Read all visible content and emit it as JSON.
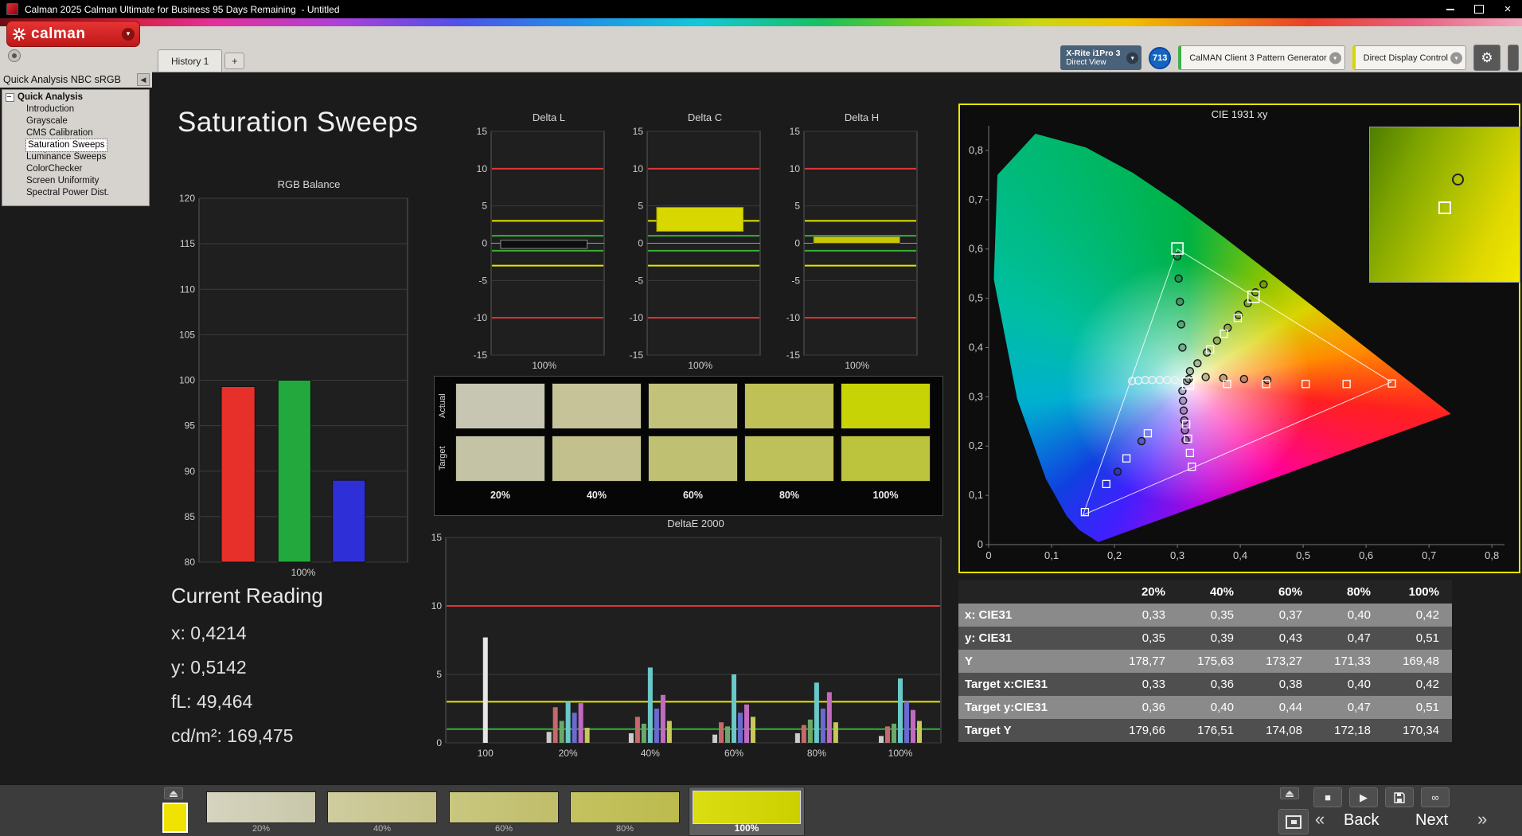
{
  "window": {
    "title": "Calman 2025 Calman Ultimate for Business 95 Days Remaining  - Untitled"
  },
  "logo": {
    "text": "calman"
  },
  "tabs": {
    "items": [
      {
        "label": "History 1"
      }
    ],
    "add_label": "+"
  },
  "devices": {
    "meter": {
      "line1": "X-Rite i1Pro 3",
      "line2": "Direct View"
    },
    "badge": "713",
    "pattern_generator": "CalMAN Client 3 Pattern Generator",
    "display_control": "Direct Display Control"
  },
  "icons": {
    "collapse": "◀",
    "dropdown": "▾",
    "gear": "⚙",
    "prev": "«",
    "next": "»",
    "stop": "■",
    "play": "▶",
    "infinity": "∞"
  },
  "sidebar": {
    "header": "Quick Analysis NBC sRGB",
    "root": "Quick Analysis",
    "items": [
      "Introduction",
      "Grayscale",
      "CMS Calibration",
      "Saturation Sweeps",
      "Luminance Sweeps",
      "ColorChecker",
      "Screen Uniformity",
      "Spectral Power Dist."
    ],
    "selected": "Saturation Sweeps"
  },
  "main": {
    "title": "Saturation Sweeps",
    "current_reading": {
      "title": "Current Reading",
      "lines": [
        "x: 0,4214",
        "y: 0,5142",
        "fL: 49,464",
        "cd/m²: 169,475"
      ]
    }
  },
  "chart_data": [
    {
      "id": "rgb_balance",
      "type": "bar",
      "title": "RGB Balance",
      "ylim": [
        80,
        120
      ],
      "ytick_step": 5,
      "categories": [
        "Red",
        "Green",
        "Blue"
      ],
      "values": [
        99.3,
        100.0,
        89.0
      ],
      "colors": [
        "#e8302a",
        "#22a83c",
        "#2f2fd8"
      ],
      "xlabel": "100%"
    },
    {
      "id": "delta_l",
      "type": "bar",
      "title": "Delta L",
      "ylim": [
        -15,
        15
      ],
      "ytick_step": 5,
      "xlabel": "100%",
      "limit_lines": [
        {
          "y": 10,
          "color": "#e03535"
        },
        {
          "y": -10,
          "color": "#e03535"
        },
        {
          "y": 3,
          "color": "#e6e600"
        },
        {
          "y": -3,
          "color": "#e6e600"
        },
        {
          "y": 1,
          "color": "#35b035"
        },
        {
          "y": -1,
          "color": "#35b035"
        }
      ],
      "bar": {
        "from": -0.7,
        "to": 0.4,
        "color": "#0d0d0d",
        "stroke": "#8a8a8a"
      }
    },
    {
      "id": "delta_c",
      "type": "bar",
      "title": "Delta C",
      "ylim": [
        -15,
        15
      ],
      "ytick_step": 5,
      "xlabel": "100%",
      "limit_lines": [
        {
          "y": 10,
          "color": "#e03535"
        },
        {
          "y": -10,
          "color": "#e03535"
        },
        {
          "y": 3,
          "color": "#e6e600"
        },
        {
          "y": -3,
          "color": "#e6e600"
        },
        {
          "y": 1,
          "color": "#35b035"
        },
        {
          "y": -1,
          "color": "#35b035"
        }
      ],
      "bar": {
        "from": 1.6,
        "to": 4.8,
        "color": "#d8d800",
        "stroke": "#9a9a00"
      }
    },
    {
      "id": "delta_h",
      "type": "bar",
      "title": "Delta H",
      "ylim": [
        -15,
        15
      ],
      "ytick_step": 5,
      "xlabel": "100%",
      "limit_lines": [
        {
          "y": 10,
          "color": "#e03535"
        },
        {
          "y": -10,
          "color": "#e03535"
        },
        {
          "y": 3,
          "color": "#e6e600"
        },
        {
          "y": -3,
          "color": "#e6e600"
        },
        {
          "y": 1,
          "color": "#35b035"
        },
        {
          "y": -1,
          "color": "#35b035"
        }
      ],
      "bar": {
        "from": 0.0,
        "to": 0.9,
        "color": "#c8c800",
        "stroke": "#555"
      }
    },
    {
      "id": "deltae",
      "type": "bar-grouped",
      "title": "DeltaE 2000",
      "ylim": [
        0,
        15
      ],
      "yticks": [
        0,
        5,
        10,
        15
      ],
      "limit_lines": [
        {
          "y": 10,
          "color": "#e03535"
        },
        {
          "y": 3,
          "color": "#e6e600"
        },
        {
          "y": 1,
          "color": "#35b035"
        }
      ],
      "groups": [
        {
          "label": "100",
          "fx": 0.08,
          "bars": [
            {
              "v": 7.7,
              "c": "#e6e6e6"
            }
          ]
        },
        {
          "label": "20%",
          "fx": 0.247,
          "bars": [
            {
              "v": 0.8,
              "c": "#cccccc"
            },
            {
              "v": 2.6,
              "c": "#c46a6a"
            },
            {
              "v": 1.6,
              "c": "#6aa86a"
            },
            {
              "v": 3.0,
              "c": "#6ac8c8"
            },
            {
              "v": 2.2,
              "c": "#6a6ad0"
            },
            {
              "v": 2.9,
              "c": "#c06ac0"
            },
            {
              "v": 1.1,
              "c": "#c8c85a"
            }
          ]
        },
        {
          "label": "40%",
          "fx": 0.413,
          "bars": [
            {
              "v": 0.7,
              "c": "#cccccc"
            },
            {
              "v": 1.9,
              "c": "#c46a6a"
            },
            {
              "v": 1.4,
              "c": "#6aa86a"
            },
            {
              "v": 5.5,
              "c": "#6ac8c8"
            },
            {
              "v": 2.5,
              "c": "#6a6ad0"
            },
            {
              "v": 3.5,
              "c": "#c06ac0"
            },
            {
              "v": 1.6,
              "c": "#c8c85a"
            }
          ]
        },
        {
          "label": "60%",
          "fx": 0.582,
          "bars": [
            {
              "v": 0.6,
              "c": "#cccccc"
            },
            {
              "v": 1.5,
              "c": "#c46a6a"
            },
            {
              "v": 1.2,
              "c": "#6aa86a"
            },
            {
              "v": 5.0,
              "c": "#6ac8c8"
            },
            {
              "v": 2.2,
              "c": "#6a6ad0"
            },
            {
              "v": 2.8,
              "c": "#c06ac0"
            },
            {
              "v": 1.9,
              "c": "#c8c85a"
            }
          ]
        },
        {
          "label": "80%",
          "fx": 0.749,
          "bars": [
            {
              "v": 0.7,
              "c": "#cccccc"
            },
            {
              "v": 1.3,
              "c": "#c46a6a"
            },
            {
              "v": 1.7,
              "c": "#6aa86a"
            },
            {
              "v": 4.4,
              "c": "#6ac8c8"
            },
            {
              "v": 2.5,
              "c": "#6a6ad0"
            },
            {
              "v": 3.7,
              "c": "#c06ac0"
            },
            {
              "v": 1.5,
              "c": "#c8c85a"
            }
          ]
        },
        {
          "label": "100%",
          "fx": 0.918,
          "bars": [
            {
              "v": 0.5,
              "c": "#cccccc"
            },
            {
              "v": 1.2,
              "c": "#c46a6a"
            },
            {
              "v": 1.4,
              "c": "#6aa86a"
            },
            {
              "v": 4.7,
              "c": "#6ac8c8"
            },
            {
              "v": 3.0,
              "c": "#6a6ad0"
            },
            {
              "v": 2.4,
              "c": "#c06ac0"
            },
            {
              "v": 1.6,
              "c": "#c8c85a"
            }
          ]
        }
      ]
    },
    {
      "id": "cie",
      "type": "scatter",
      "title": "CIE 1931 xy",
      "xmax": 0.82,
      "ymax": 0.85,
      "tick_values": [
        0,
        0.1,
        0.2,
        0.3,
        0.4,
        0.5,
        0.6,
        0.7,
        0.8
      ],
      "tick_labels": [
        "0",
        "0,1",
        "0,2",
        "0,3",
        "0,4",
        "0,5",
        "0,6",
        "0,7",
        "0,8"
      ],
      "locus": [
        [
          0.1741,
          0.005
        ],
        [
          0.144,
          0.0297
        ],
        [
          0.1241,
          0.0578
        ],
        [
          0.0913,
          0.1327
        ],
        [
          0.0454,
          0.295
        ],
        [
          0.0082,
          0.5384
        ],
        [
          0.0139,
          0.7502
        ],
        [
          0.0743,
          0.8338
        ],
        [
          0.1547,
          0.8059
        ],
        [
          0.2296,
          0.7543
        ],
        [
          0.3016,
          0.6923
        ],
        [
          0.3731,
          0.6245
        ],
        [
          0.4441,
          0.5547
        ],
        [
          0.5125,
          0.4866
        ],
        [
          0.5752,
          0.4242
        ],
        [
          0.627,
          0.3725
        ],
        [
          0.6658,
          0.334
        ],
        [
          0.6915,
          0.3083
        ],
        [
          0.7347,
          0.2653
        ]
      ],
      "gamut_triangle": [
        [
          0.64,
          0.33
        ],
        [
          0.3,
          0.6
        ],
        [
          0.15,
          0.06
        ]
      ],
      "measured": [
        [
          0.3,
          0.585
        ],
        [
          0.302,
          0.54
        ],
        [
          0.304,
          0.493
        ],
        [
          0.306,
          0.447
        ],
        [
          0.308,
          0.4
        ],
        [
          0.32,
          0.352
        ],
        [
          0.332,
          0.368
        ],
        [
          0.347,
          0.39
        ],
        [
          0.363,
          0.414
        ],
        [
          0.38,
          0.44
        ],
        [
          0.397,
          0.466
        ],
        [
          0.412,
          0.49
        ],
        [
          0.424,
          0.512
        ],
        [
          0.437,
          0.528
        ],
        [
          0.345,
          0.34
        ],
        [
          0.373,
          0.338
        ],
        [
          0.406,
          0.336
        ],
        [
          0.443,
          0.334
        ],
        [
          0.308,
          0.312
        ],
        [
          0.309,
          0.292
        ],
        [
          0.31,
          0.272
        ],
        [
          0.311,
          0.252
        ],
        [
          0.312,
          0.232
        ],
        [
          0.313,
          0.212
        ],
        [
          0.243,
          0.21
        ],
        [
          0.205,
          0.148
        ],
        [
          0.315,
          0.332
        ],
        [
          0.318,
          0.336
        ]
      ],
      "measured_light": [
        [
          0.296,
          0.334
        ],
        [
          0.284,
          0.334
        ],
        [
          0.272,
          0.334
        ],
        [
          0.26,
          0.334
        ],
        [
          0.249,
          0.334
        ],
        [
          0.238,
          0.333
        ],
        [
          0.228,
          0.332
        ]
      ],
      "targets": [
        [
          0.379,
          0.326
        ],
        [
          0.441,
          0.326
        ],
        [
          0.504,
          0.326
        ],
        [
          0.569,
          0.326
        ],
        [
          0.641,
          0.327
        ],
        [
          0.352,
          0.396
        ],
        [
          0.374,
          0.428
        ],
        [
          0.396,
          0.46
        ],
        [
          0.253,
          0.226
        ],
        [
          0.219,
          0.175
        ],
        [
          0.187,
          0.123
        ],
        [
          0.153,
          0.066
        ],
        [
          0.314,
          0.244
        ],
        [
          0.317,
          0.215
        ],
        [
          0.32,
          0.186
        ],
        [
          0.323,
          0.158
        ]
      ],
      "big_targets": [
        [
          0.3,
          0.601
        ],
        [
          0.421,
          0.503
        ],
        [
          0.317,
          0.327
        ]
      ]
    }
  ],
  "swatches": {
    "columns": [
      "20%",
      "40%",
      "60%",
      "80%",
      "100%"
    ],
    "rows": [
      {
        "label": "Actual",
        "colors": [
          "#c6c6b3",
          "#c6c398",
          "#c2c27b",
          "#bfc156",
          "#c8d306"
        ]
      },
      {
        "label": "Target",
        "colors": [
          "#c4c3a5",
          "#c2c18d",
          "#c0c073",
          "#bec05a",
          "#bcc33c"
        ]
      }
    ]
  },
  "table": {
    "columns": [
      "",
      "20%",
      "40%",
      "60%",
      "80%",
      "100%"
    ],
    "rows": [
      {
        "label": "x: CIE31",
        "values": [
          "0,33",
          "0,35",
          "0,37",
          "0,40",
          "0,42"
        ]
      },
      {
        "label": "y: CIE31",
        "values": [
          "0,35",
          "0,39",
          "0,43",
          "0,47",
          "0,51"
        ]
      },
      {
        "label": "Y",
        "values": [
          "178,77",
          "175,63",
          "173,27",
          "171,33",
          "169,48"
        ]
      },
      {
        "label": "Target x:CIE31",
        "values": [
          "0,33",
          "0,36",
          "0,38",
          "0,40",
          "0,42"
        ]
      },
      {
        "label": "Target y:CIE31",
        "values": [
          "0,36",
          "0,40",
          "0,44",
          "0,47",
          "0,51"
        ]
      },
      {
        "label": "Target Y",
        "values": [
          "179,66",
          "176,51",
          "174,08",
          "172,18",
          "170,34"
        ]
      }
    ]
  },
  "bottom": {
    "patches": [
      {
        "label": "20%",
        "from": "#d6d4bf",
        "to": "#c9c7a9"
      },
      {
        "label": "40%",
        "from": "#cfcc9f",
        "to": "#c5c287"
      },
      {
        "label": "60%",
        "from": "#c9c77f",
        "to": "#c0be69"
      },
      {
        "label": "80%",
        "from": "#c4c260",
        "to": "#bcbb4e"
      },
      {
        "label": "100%",
        "from": "#dade12",
        "to": "#ccd000",
        "selected": true
      }
    ],
    "current_patch_color": "#f0e202",
    "back": "Back",
    "next": "Next"
  }
}
